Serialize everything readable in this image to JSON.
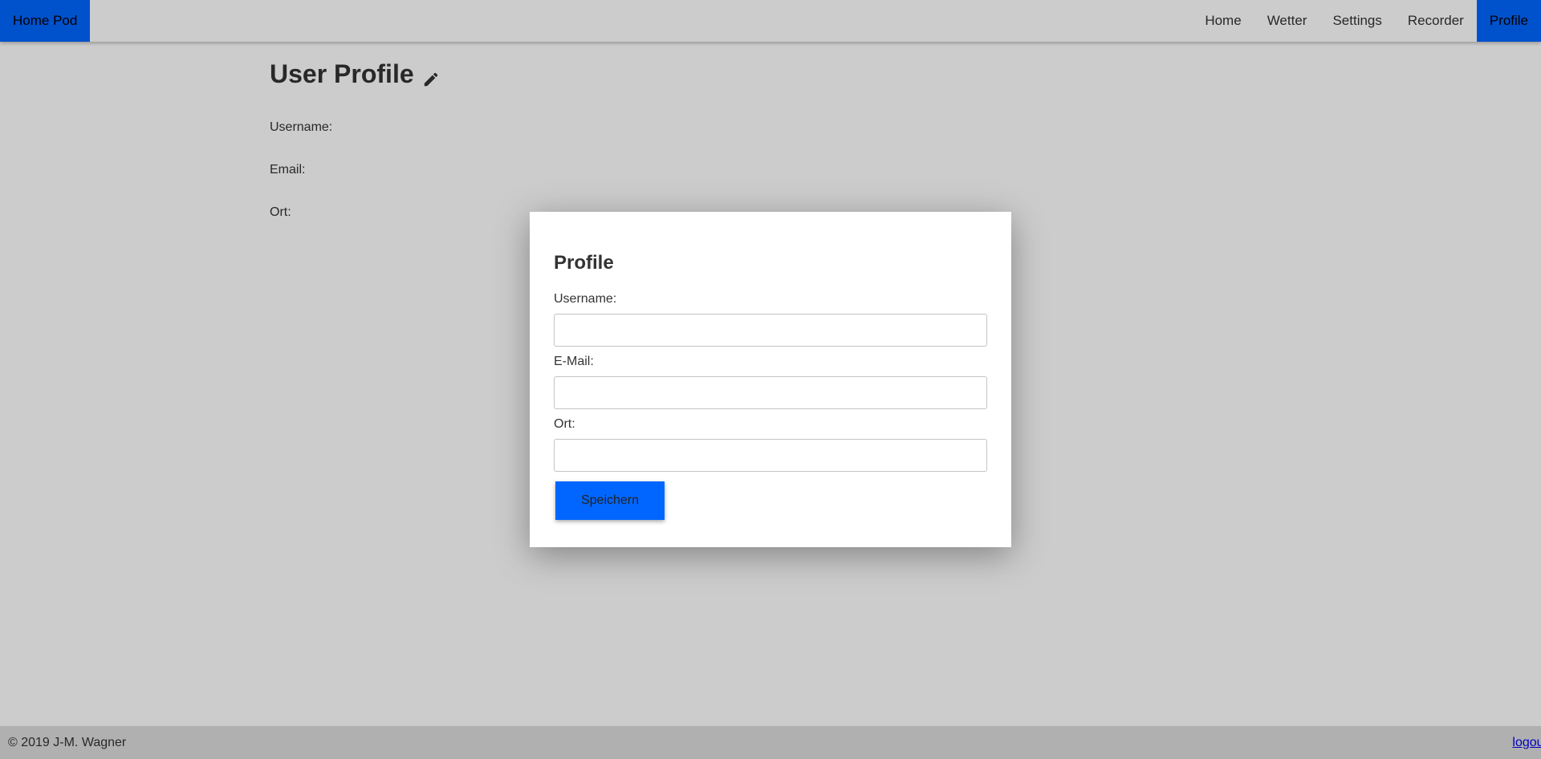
{
  "navbar": {
    "brand": "Home Pod",
    "links": [
      "Home",
      "Wetter",
      "Settings",
      "Recorder",
      "Profile"
    ],
    "active": "Profile"
  },
  "page": {
    "title": "User Profile",
    "edit_icon": "pencil-icon",
    "fields": {
      "username_label": "Username:",
      "email_label": "Email:",
      "ort_label": "Ort:"
    }
  },
  "modal": {
    "title": "Profile",
    "username_label": "Username:",
    "email_label": "E-Mail:",
    "ort_label": "Ort:",
    "username_value": "",
    "email_value": "",
    "ort_value": "",
    "save_label": "Speichern"
  },
  "footer": {
    "copyright": "© 2019 J-M. Wagner",
    "logout": "logout"
  },
  "colors": {
    "accent": "#0066ff",
    "overlay": "rgba(0,0,0,0.2)"
  }
}
